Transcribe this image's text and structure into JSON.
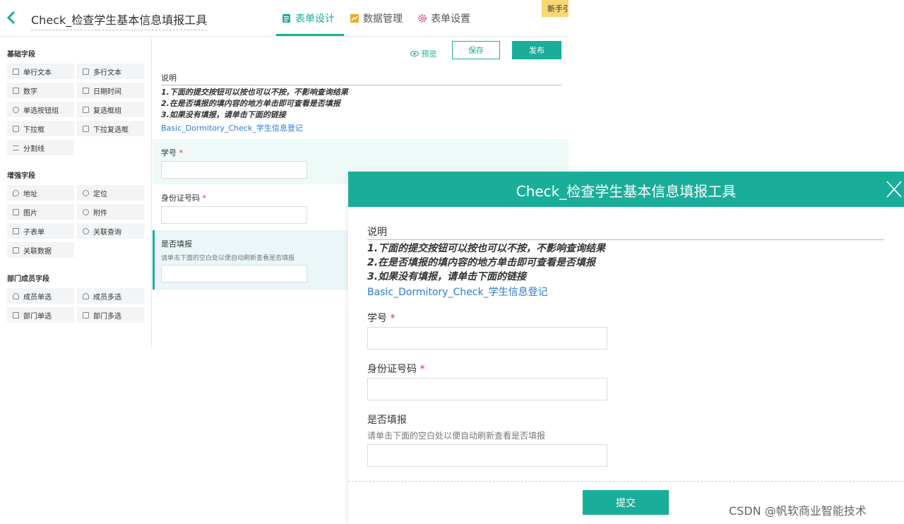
{
  "editor": {
    "back_icon": "chevron-left-icon",
    "title": "Check_检查学生基本信息填报工具",
    "tabs": [
      {
        "label": "表单设计",
        "icon": "form-icon",
        "active": true
      },
      {
        "label": "数据管理",
        "icon": "chart-icon",
        "active": false
      },
      {
        "label": "表单设置",
        "icon": "gear-icon",
        "active": false
      }
    ],
    "newbie_badge": "新手引",
    "accent": "#1aae9a"
  },
  "sidebar": {
    "groups": [
      {
        "title": "基础字段",
        "items": [
          "单行文本",
          "多行文本",
          "数字",
          "日期时间",
          "单选按钮组",
          "复选框组",
          "下拉框",
          "下拉复选框",
          "分割线"
        ]
      },
      {
        "title": "增强字段",
        "items": [
          "地址",
          "定位",
          "图片",
          "附件",
          "子表单",
          "关联查询",
          "关联数据"
        ]
      },
      {
        "title": "部门成员字段",
        "items": [
          "成员单选",
          "成员多选",
          "部门单选",
          "部门多选"
        ]
      }
    ]
  },
  "toolbar": {
    "preview": "预览",
    "save": "保存",
    "publish": "发布"
  },
  "form": {
    "desc_label": "说明",
    "desc_lines": [
      "1.下面的提交按钮可以按也可以不按，不影响查询结果",
      "2.在是否填报的填内容的地方单击即可查看是否填报",
      "3.如果没有填报，请单击下面的链接"
    ],
    "link": "Basic_Dormitory_Check_学生信息登记",
    "fields": [
      {
        "label": "学号",
        "required": "*"
      },
      {
        "label": "身份证号码",
        "required": "*"
      },
      {
        "label": "是否填报",
        "hint": "请单击下面的空白处以便自动刷新查看是否填报"
      }
    ]
  },
  "dialog": {
    "title": "Check_检查学生基本信息填报工具",
    "submit": "提交"
  },
  "watermark": "CSDN @帆软商业智能技术"
}
